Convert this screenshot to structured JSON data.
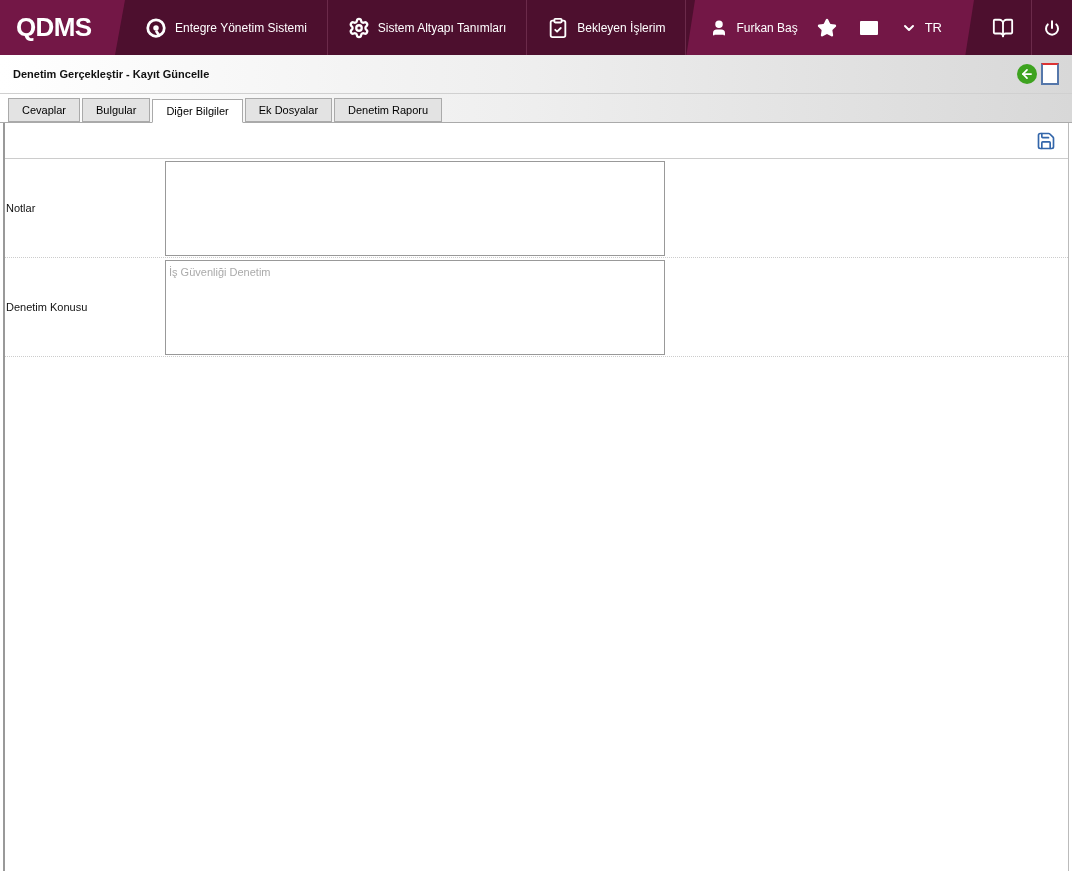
{
  "header": {
    "logo": "QDMS",
    "nav": [
      {
        "label": "Entegre Yönetim Sistemi"
      },
      {
        "label": "Sistem Altyapı Tanımları"
      },
      {
        "label": "Bekleyen İşlerim"
      }
    ],
    "user": "Furkan Baş",
    "language": "TR"
  },
  "page": {
    "title": "Denetim Gerçekleştir - Kayıt Güncelle"
  },
  "tabs": [
    {
      "label": "Cevaplar",
      "selected": false
    },
    {
      "label": "Bulgular",
      "selected": false
    },
    {
      "label": "Diğer Bilgiler",
      "selected": true
    },
    {
      "label": "Ek Dosyalar",
      "selected": false
    },
    {
      "label": "Denetim Raporu",
      "selected": false
    }
  ],
  "form": [
    {
      "label": "Notlar"
    },
    {
      "label": "Denetim Konusu",
      "value": "İş Güvenliği Denetim"
    }
  ]
}
